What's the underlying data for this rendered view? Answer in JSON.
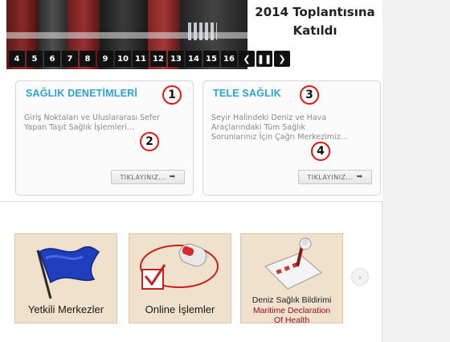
{
  "slider": {
    "caption_line1": "2014 Toplantısına",
    "caption_line2": "Katıldı",
    "pages": [
      "4",
      "5",
      "6",
      "7",
      "8",
      "9",
      "10",
      "11",
      "12",
      "13",
      "14",
      "15",
      "16"
    ],
    "prev_label": "❮",
    "pause_label": "❚❚",
    "next_label": "❯"
  },
  "boxes": [
    {
      "title": "SAĞLIK DENETİMLERİ",
      "text": "Giriş Noktaları ve Uluslararası Sefer Yapan Taşıt Sağlık İşlemleri...",
      "button": "TIKLAYINIZ..."
    },
    {
      "title": "TELE SAĞLIK",
      "text": "Seyir Halindeki Deniz ve Hava Araçlarındaki Tüm Sağlık Sorunlarınız İçin Çağrı Merkezimiz...",
      "button": "TIKLAYINIZ..."
    }
  ],
  "badges": [
    "1",
    "2",
    "3",
    "4"
  ],
  "services": [
    {
      "label": "Yetkili Merkezler",
      "icon": "flag-icon"
    },
    {
      "label": "Online İşlemler",
      "icon": "mouse-checkbox-icon"
    },
    {
      "line1": "Deniz Sağlık Bildirimi",
      "line2": "Maritime Declaration",
      "line3": "Of Health",
      "icon": "checklist-pen-icon"
    }
  ],
  "carousel_next": "›",
  "colors": {
    "title_blue": "#2aa3d6",
    "badge_red": "#e11111",
    "maroon": "#a0102a"
  }
}
